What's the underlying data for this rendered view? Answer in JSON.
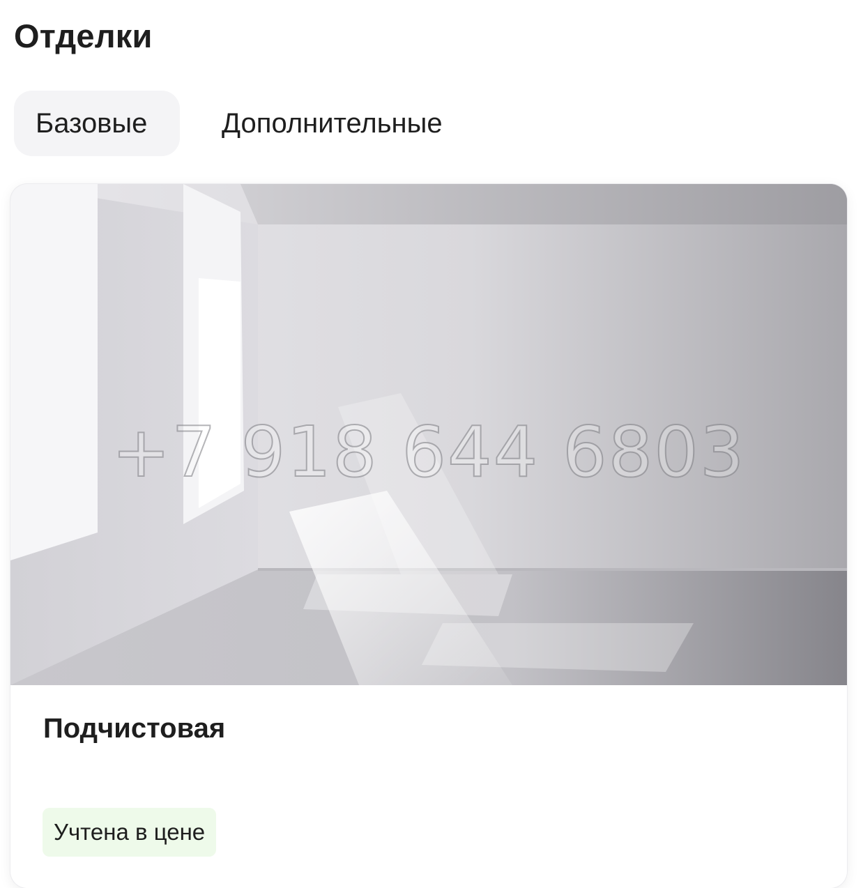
{
  "section": {
    "title": "Отделки"
  },
  "tabs": [
    {
      "label": "Базовые",
      "active": true
    },
    {
      "label": "Дополнительные",
      "active": false
    }
  ],
  "card": {
    "title": "Подчистовая",
    "badge": "Учтена в цене",
    "watermark": "+7 918 644 6803",
    "badge_color": "#eefaea"
  }
}
